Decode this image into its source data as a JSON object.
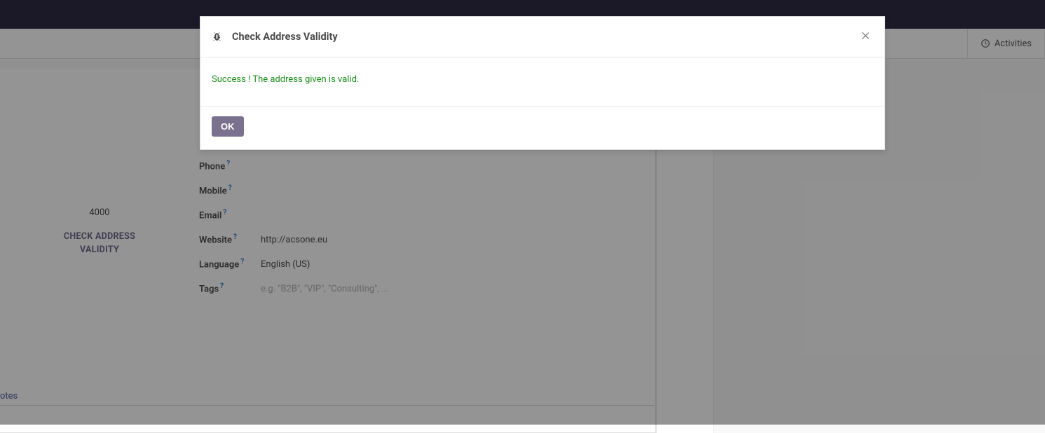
{
  "toolbar": {
    "activities_label": "Activities"
  },
  "record": {
    "zip": "4000",
    "check_btn_line1": "CHECK ADDRESS",
    "check_btn_line2": "VALIDITY",
    "fields": {
      "phone_label": "Phone",
      "mobile_label": "Mobile",
      "email_label": "Email",
      "website_label": "Website",
      "website_value": "http://acsone.eu",
      "language_label": "Language",
      "language_value": "English (US)",
      "tags_label": "Tags",
      "tags_placeholder": "e.g. \"B2B\", \"VIP\", \"Consulting\", ..."
    },
    "help_marker": "?",
    "notes_tab": "otes"
  },
  "modal": {
    "title": "Check Address Validity",
    "success_message": "Success ! The address given is valid.",
    "ok_label": "OK"
  }
}
